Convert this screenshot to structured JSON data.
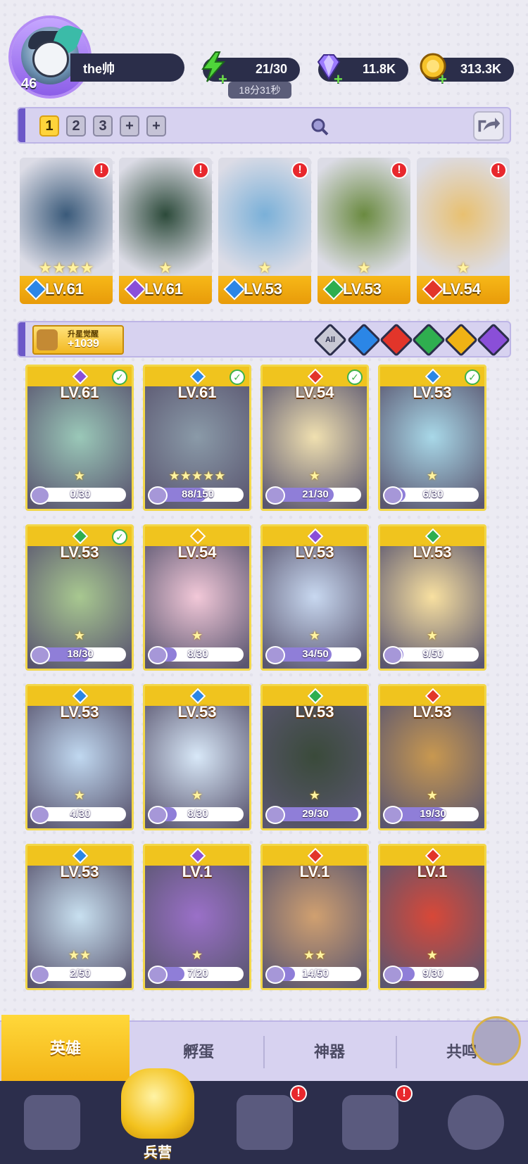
{
  "player": {
    "level": "46",
    "name": "the帅"
  },
  "resources": {
    "energy": {
      "value": "21/30",
      "timer": "18分31秒"
    },
    "gems": {
      "value": "11.8K"
    },
    "coins": {
      "value": "313.3K"
    }
  },
  "team_tabs": [
    "1",
    "2",
    "3",
    "+",
    "+"
  ],
  "team_heroes": [
    {
      "level": "LV.61",
      "element": "water",
      "stars": "★★★★",
      "alert": "!"
    },
    {
      "level": "LV.61",
      "element": "dark",
      "stars": "★",
      "alert": "!"
    },
    {
      "level": "LV.53",
      "element": "water",
      "stars": "★",
      "alert": "!"
    },
    {
      "level": "LV.53",
      "element": "nature",
      "stars": "★",
      "alert": "!"
    },
    {
      "level": "LV.54",
      "element": "fire",
      "stars": "★",
      "alert": "!"
    }
  ],
  "awaken": {
    "label": "升星觉醒",
    "value": "+1039"
  },
  "filters": {
    "all_label": "All"
  },
  "heroes": [
    {
      "level": "LV.61",
      "element": "dark",
      "progress": "0/30",
      "fraction": 0.0,
      "checked": true,
      "stars": "★"
    },
    {
      "level": "LV.61",
      "element": "water",
      "progress": "88/150",
      "fraction": 0.59,
      "checked": true,
      "stars": "★★★★★"
    },
    {
      "level": "LV.54",
      "element": "fire",
      "progress": "21/30",
      "fraction": 0.7,
      "checked": true,
      "stars": "★"
    },
    {
      "level": "LV.53",
      "element": "water",
      "progress": "6/30",
      "fraction": 0.2,
      "checked": true,
      "stars": "★"
    },
    {
      "level": "LV.53",
      "element": "nature",
      "progress": "18/30",
      "fraction": 0.6,
      "checked": true,
      "stars": "★"
    },
    {
      "level": "LV.54",
      "element": "light",
      "progress": "8/30",
      "fraction": 0.27,
      "checked": false,
      "stars": "★"
    },
    {
      "level": "LV.53",
      "element": "dark",
      "progress": "34/50",
      "fraction": 0.68,
      "checked": false,
      "stars": "★"
    },
    {
      "level": "LV.53",
      "element": "nature",
      "progress": "9/50",
      "fraction": 0.18,
      "checked": false,
      "stars": "★"
    },
    {
      "level": "LV.53",
      "element": "water",
      "progress": "4/30",
      "fraction": 0.13,
      "checked": false,
      "stars": "★"
    },
    {
      "level": "LV.53",
      "element": "water",
      "progress": "8/30",
      "fraction": 0.27,
      "checked": false,
      "stars": "★"
    },
    {
      "level": "LV.53",
      "element": "nature",
      "progress": "29/30",
      "fraction": 0.97,
      "checked": false,
      "stars": "★"
    },
    {
      "level": "LV.53",
      "element": "fire",
      "progress": "19/30",
      "fraction": 0.63,
      "checked": false,
      "stars": "★"
    },
    {
      "level": "LV.53",
      "element": "water",
      "progress": "2/50",
      "fraction": 0.04,
      "checked": false,
      "stars": "★★"
    },
    {
      "level": "LV.1",
      "element": "dark",
      "progress": "7/20",
      "fraction": 0.35,
      "checked": false,
      "stars": "★"
    },
    {
      "level": "LV.1",
      "element": "fire",
      "progress": "14/50",
      "fraction": 0.28,
      "checked": false,
      "stars": "★★"
    },
    {
      "level": "LV.1",
      "element": "fire",
      "progress": "9/30",
      "fraction": 0.3,
      "checked": false,
      "stars": "★"
    }
  ],
  "sub_tabs": [
    "英雄",
    "孵蛋",
    "神器",
    "共鸣"
  ],
  "nav": {
    "main_label": "兵营",
    "alert": "!"
  },
  "colors": {
    "water": "#2b86e6",
    "dark": "#8a4fd8",
    "fire": "#e2352a",
    "nature": "#2fae4f",
    "light": "#f0b214"
  }
}
